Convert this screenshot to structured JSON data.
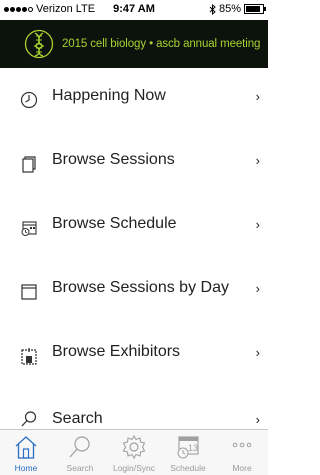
{
  "status_bar": {
    "carrier": "Verizon",
    "network": "LTE",
    "time": "9:47 AM",
    "battery_percent": "85%",
    "battery_level": 0.85,
    "bluetooth_icon": "bluetooth-icon"
  },
  "banner": {
    "text": "2015 cell biology • ascb annual meeting",
    "text_color": "#a8d22f",
    "background": "#0c120c"
  },
  "menu": {
    "items": [
      {
        "label": "Happening Now",
        "icon": "clock-icon"
      },
      {
        "label": "Browse Sessions",
        "icon": "documents-icon"
      },
      {
        "label": "Browse Schedule",
        "icon": "calendar-clock-icon"
      },
      {
        "label": "Browse Sessions by Day",
        "icon": "calendar-icon"
      },
      {
        "label": "Browse Exhibitors",
        "icon": "exhibitor-icon"
      }
    ],
    "search": {
      "label": "Search",
      "icon": "search-icon"
    },
    "chevron": "›"
  },
  "tabbar": {
    "tabs": [
      {
        "label": "Home",
        "icon": "home-icon",
        "active": true
      },
      {
        "label": "Search",
        "icon": "search-icon"
      },
      {
        "label": "Login/Sync",
        "icon": "gear-icon"
      },
      {
        "label": "Schedule",
        "icon": "calendar-icon"
      },
      {
        "label": "More",
        "icon": "more-icon"
      }
    ],
    "active_color": "#2a6fc4",
    "inactive_color": "#9a9a9a"
  }
}
